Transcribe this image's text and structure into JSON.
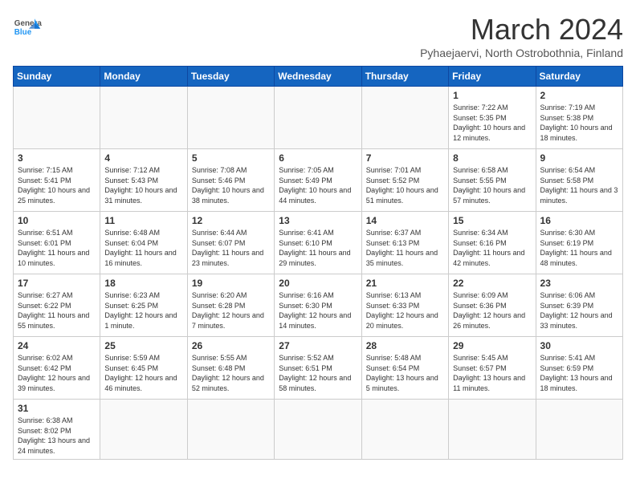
{
  "header": {
    "logo_general": "General",
    "logo_blue": "Blue",
    "month_title": "March 2024",
    "subtitle": "Pyhaejaervi, North Ostrobothnia, Finland"
  },
  "weekdays": [
    "Sunday",
    "Monday",
    "Tuesday",
    "Wednesday",
    "Thursday",
    "Friday",
    "Saturday"
  ],
  "weeks": [
    [
      {
        "day": "",
        "info": ""
      },
      {
        "day": "",
        "info": ""
      },
      {
        "day": "",
        "info": ""
      },
      {
        "day": "",
        "info": ""
      },
      {
        "day": "",
        "info": ""
      },
      {
        "day": "1",
        "info": "Sunrise: 7:22 AM\nSunset: 5:35 PM\nDaylight: 10 hours and 12 minutes."
      },
      {
        "day": "2",
        "info": "Sunrise: 7:19 AM\nSunset: 5:38 PM\nDaylight: 10 hours and 18 minutes."
      }
    ],
    [
      {
        "day": "3",
        "info": "Sunrise: 7:15 AM\nSunset: 5:41 PM\nDaylight: 10 hours and 25 minutes."
      },
      {
        "day": "4",
        "info": "Sunrise: 7:12 AM\nSunset: 5:43 PM\nDaylight: 10 hours and 31 minutes."
      },
      {
        "day": "5",
        "info": "Sunrise: 7:08 AM\nSunset: 5:46 PM\nDaylight: 10 hours and 38 minutes."
      },
      {
        "day": "6",
        "info": "Sunrise: 7:05 AM\nSunset: 5:49 PM\nDaylight: 10 hours and 44 minutes."
      },
      {
        "day": "7",
        "info": "Sunrise: 7:01 AM\nSunset: 5:52 PM\nDaylight: 10 hours and 51 minutes."
      },
      {
        "day": "8",
        "info": "Sunrise: 6:58 AM\nSunset: 5:55 PM\nDaylight: 10 hours and 57 minutes."
      },
      {
        "day": "9",
        "info": "Sunrise: 6:54 AM\nSunset: 5:58 PM\nDaylight: 11 hours and 3 minutes."
      }
    ],
    [
      {
        "day": "10",
        "info": "Sunrise: 6:51 AM\nSunset: 6:01 PM\nDaylight: 11 hours and 10 minutes."
      },
      {
        "day": "11",
        "info": "Sunrise: 6:48 AM\nSunset: 6:04 PM\nDaylight: 11 hours and 16 minutes."
      },
      {
        "day": "12",
        "info": "Sunrise: 6:44 AM\nSunset: 6:07 PM\nDaylight: 11 hours and 23 minutes."
      },
      {
        "day": "13",
        "info": "Sunrise: 6:41 AM\nSunset: 6:10 PM\nDaylight: 11 hours and 29 minutes."
      },
      {
        "day": "14",
        "info": "Sunrise: 6:37 AM\nSunset: 6:13 PM\nDaylight: 11 hours and 35 minutes."
      },
      {
        "day": "15",
        "info": "Sunrise: 6:34 AM\nSunset: 6:16 PM\nDaylight: 11 hours and 42 minutes."
      },
      {
        "day": "16",
        "info": "Sunrise: 6:30 AM\nSunset: 6:19 PM\nDaylight: 11 hours and 48 minutes."
      }
    ],
    [
      {
        "day": "17",
        "info": "Sunrise: 6:27 AM\nSunset: 6:22 PM\nDaylight: 11 hours and 55 minutes."
      },
      {
        "day": "18",
        "info": "Sunrise: 6:23 AM\nSunset: 6:25 PM\nDaylight: 12 hours and 1 minute."
      },
      {
        "day": "19",
        "info": "Sunrise: 6:20 AM\nSunset: 6:28 PM\nDaylight: 12 hours and 7 minutes."
      },
      {
        "day": "20",
        "info": "Sunrise: 6:16 AM\nSunset: 6:30 PM\nDaylight: 12 hours and 14 minutes."
      },
      {
        "day": "21",
        "info": "Sunrise: 6:13 AM\nSunset: 6:33 PM\nDaylight: 12 hours and 20 minutes."
      },
      {
        "day": "22",
        "info": "Sunrise: 6:09 AM\nSunset: 6:36 PM\nDaylight: 12 hours and 26 minutes."
      },
      {
        "day": "23",
        "info": "Sunrise: 6:06 AM\nSunset: 6:39 PM\nDaylight: 12 hours and 33 minutes."
      }
    ],
    [
      {
        "day": "24",
        "info": "Sunrise: 6:02 AM\nSunset: 6:42 PM\nDaylight: 12 hours and 39 minutes."
      },
      {
        "day": "25",
        "info": "Sunrise: 5:59 AM\nSunset: 6:45 PM\nDaylight: 12 hours and 46 minutes."
      },
      {
        "day": "26",
        "info": "Sunrise: 5:55 AM\nSunset: 6:48 PM\nDaylight: 12 hours and 52 minutes."
      },
      {
        "day": "27",
        "info": "Sunrise: 5:52 AM\nSunset: 6:51 PM\nDaylight: 12 hours and 58 minutes."
      },
      {
        "day": "28",
        "info": "Sunrise: 5:48 AM\nSunset: 6:54 PM\nDaylight: 13 hours and 5 minutes."
      },
      {
        "day": "29",
        "info": "Sunrise: 5:45 AM\nSunset: 6:57 PM\nDaylight: 13 hours and 11 minutes."
      },
      {
        "day": "30",
        "info": "Sunrise: 5:41 AM\nSunset: 6:59 PM\nDaylight: 13 hours and 18 minutes."
      }
    ],
    [
      {
        "day": "31",
        "info": "Sunrise: 6:38 AM\nSunset: 8:02 PM\nDaylight: 13 hours and 24 minutes."
      },
      {
        "day": "",
        "info": ""
      },
      {
        "day": "",
        "info": ""
      },
      {
        "day": "",
        "info": ""
      },
      {
        "day": "",
        "info": ""
      },
      {
        "day": "",
        "info": ""
      },
      {
        "day": "",
        "info": ""
      }
    ]
  ]
}
